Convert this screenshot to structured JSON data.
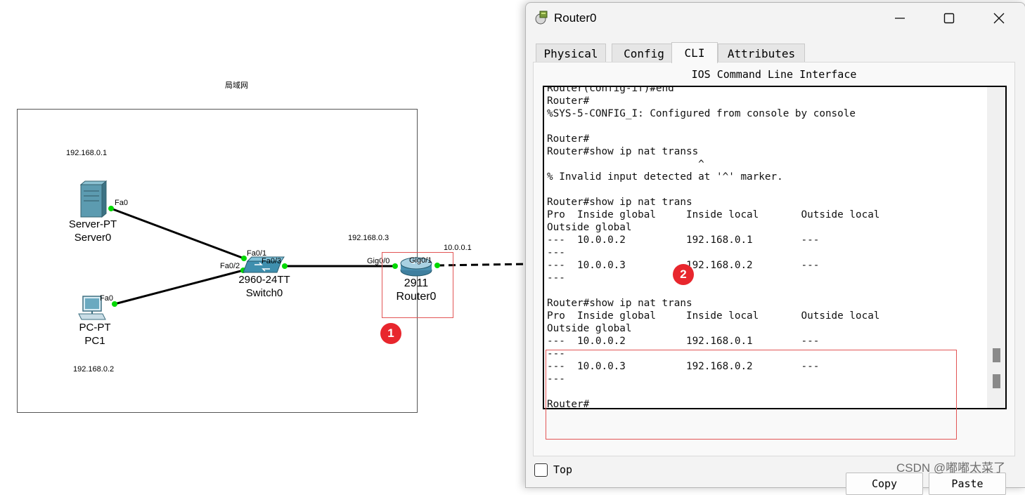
{
  "topology": {
    "area_label": "局域网",
    "server": {
      "ip": "192.168.0.1",
      "model": "Server-PT",
      "name": "Server0",
      "port": "Fa0"
    },
    "pc": {
      "ip": "192.168.0.2",
      "model": "PC-PT",
      "name": "PC1",
      "port": "Fa0"
    },
    "switch": {
      "model": "2960-24TT",
      "name": "Switch0",
      "ports": [
        "Fa0/1",
        "Fa0/2",
        "Fa0/3"
      ]
    },
    "router": {
      "ip": "192.168.0.3",
      "model": "2911",
      "name": "Router0",
      "port_lan": "Gig0/0",
      "port_wan": "Gig0/1",
      "wan_ip": "10.0.0.1"
    },
    "link_color": "#00d800",
    "badges": [
      "1",
      "2"
    ]
  },
  "window": {
    "title": "Router0",
    "tabs": [
      {
        "label": "Physical",
        "active": false
      },
      {
        "label": "Config",
        "active": false
      },
      {
        "label": "CLI",
        "active": true
      },
      {
        "label": "Attributes",
        "active": false
      }
    ],
    "cli_title": "IOS Command Line Interface",
    "terminal_lines": [
      "Router(config-if)#end",
      "Router#",
      "%SYS-5-CONFIG_I: Configured from console by console",
      "",
      "Router#",
      "Router#show ip nat transs",
      "                         ^",
      "% Invalid input detected at '^' marker.",
      "",
      "Router#show ip nat trans",
      "Pro  Inside global     Inside local       Outside local",
      "Outside global",
      "---  10.0.0.2          192.168.0.1        ---",
      "---",
      "---  10.0.0.3          192.168.0.2        ---",
      "---",
      "",
      "Router#show ip nat trans",
      "Pro  Inside global     Inside local       Outside local",
      "Outside global",
      "---  10.0.0.2          192.168.0.1        ---",
      "---",
      "---  10.0.0.3          192.168.0.2        ---",
      "---",
      "",
      "Router#"
    ],
    "copy_label": "Copy",
    "paste_label": "Paste",
    "top_label": "Top",
    "top_checked": false
  },
  "watermark": "CSDN @嘟嘟太菜了",
  "colors": {
    "highlight": "#e25555",
    "badge": "#e8262d"
  }
}
